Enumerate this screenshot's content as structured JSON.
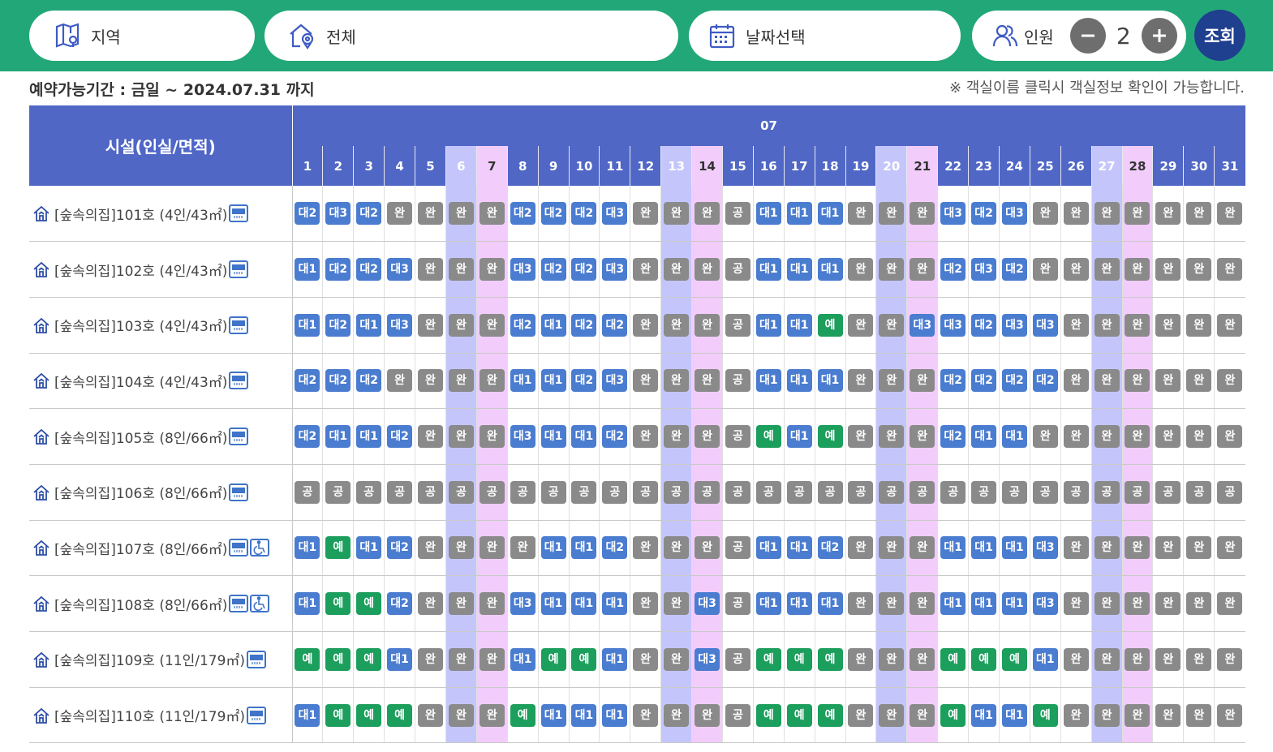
{
  "search": {
    "region_label": "지역",
    "category_label": "전체",
    "date_label": "날짜선택",
    "people_label": "인원",
    "people_count": "2",
    "search_button": "조회"
  },
  "info": {
    "period": "예약가능기간 : 금일 ~ 2024.07.31 까지",
    "notice": "※ 객실이름 클릭시 객실정보 확인이 가능합니다."
  },
  "table": {
    "facility_header": "시설(인실/면적)",
    "month": "07",
    "days": [
      "1",
      "2",
      "3",
      "4",
      "5",
      "6",
      "7",
      "8",
      "9",
      "10",
      "11",
      "12",
      "13",
      "14",
      "15",
      "16",
      "17",
      "18",
      "19",
      "20",
      "21",
      "22",
      "23",
      "24",
      "25",
      "26",
      "27",
      "28",
      "29",
      "30",
      "31"
    ],
    "day_types": [
      "wd",
      "wd",
      "wd",
      "wd",
      "wd",
      "sat",
      "sun",
      "wd",
      "wd",
      "wd",
      "wd",
      "wd",
      "sat",
      "sun",
      "wd",
      "wd",
      "wd",
      "wd",
      "wd",
      "sat",
      "sun",
      "wd",
      "wd",
      "wd",
      "wd",
      "wd",
      "sat",
      "sun",
      "wd",
      "wd",
      "wd"
    ],
    "rooms": [
      {
        "name": "[숲속의집]101호 (4인/43㎡)",
        "accessible": false,
        "cells": [
          "대2",
          "대3",
          "대2",
          "완",
          "완",
          "완",
          "완",
          "대2",
          "대2",
          "대2",
          "대3",
          "완",
          "완",
          "완",
          "공",
          "대1",
          "대1",
          "대1",
          "완",
          "완",
          "완",
          "대3",
          "대2",
          "대3",
          "완",
          "완",
          "완",
          "완",
          "완",
          "완",
          "완"
        ]
      },
      {
        "name": "[숲속의집]102호 (4인/43㎡)",
        "accessible": false,
        "cells": [
          "대1",
          "대2",
          "대2",
          "대3",
          "완",
          "완",
          "완",
          "대3",
          "대2",
          "대2",
          "대3",
          "완",
          "완",
          "완",
          "공",
          "대1",
          "대1",
          "대1",
          "완",
          "완",
          "완",
          "대2",
          "대3",
          "대2",
          "완",
          "완",
          "완",
          "완",
          "완",
          "완",
          "완"
        ]
      },
      {
        "name": "[숲속의집]103호 (4인/43㎡)",
        "accessible": false,
        "cells": [
          "대1",
          "대2",
          "대1",
          "대3",
          "완",
          "완",
          "완",
          "대2",
          "대1",
          "대2",
          "대2",
          "완",
          "완",
          "완",
          "공",
          "대1",
          "대1",
          "예",
          "완",
          "완",
          "대3",
          "대3",
          "대2",
          "대3",
          "대3",
          "완",
          "완",
          "완",
          "완",
          "완",
          "완"
        ]
      },
      {
        "name": "[숲속의집]104호 (4인/43㎡)",
        "accessible": false,
        "cells": [
          "대2",
          "대2",
          "대2",
          "완",
          "완",
          "완",
          "완",
          "대1",
          "대1",
          "대2",
          "대3",
          "완",
          "완",
          "완",
          "공",
          "대1",
          "대1",
          "대1",
          "완",
          "완",
          "완",
          "대2",
          "대2",
          "대2",
          "대2",
          "완",
          "완",
          "완",
          "완",
          "완",
          "완"
        ]
      },
      {
        "name": "[숲속의집]105호 (8인/66㎡)",
        "accessible": false,
        "cells": [
          "대2",
          "대1",
          "대1",
          "대2",
          "완",
          "완",
          "완",
          "대3",
          "대1",
          "대1",
          "대2",
          "완",
          "완",
          "완",
          "공",
          "예",
          "대1",
          "예",
          "완",
          "완",
          "완",
          "대2",
          "대1",
          "대1",
          "완",
          "완",
          "완",
          "완",
          "완",
          "완",
          "완"
        ]
      },
      {
        "name": "[숲속의집]106호 (8인/66㎡)",
        "accessible": false,
        "cells": [
          "공",
          "공",
          "공",
          "공",
          "공",
          "공",
          "공",
          "공",
          "공",
          "공",
          "공",
          "공",
          "공",
          "공",
          "공",
          "공",
          "공",
          "공",
          "공",
          "공",
          "공",
          "공",
          "공",
          "공",
          "공",
          "공",
          "공",
          "공",
          "공",
          "공",
          "공"
        ]
      },
      {
        "name": "[숲속의집]107호 (8인/66㎡)",
        "accessible": true,
        "cells": [
          "대1",
          "예",
          "대1",
          "대2",
          "완",
          "완",
          "완",
          "완",
          "대1",
          "대1",
          "대2",
          "완",
          "완",
          "완",
          "공",
          "대1",
          "대1",
          "대2",
          "완",
          "완",
          "완",
          "대1",
          "대1",
          "대1",
          "대3",
          "완",
          "완",
          "완",
          "완",
          "완",
          "완"
        ]
      },
      {
        "name": "[숲속의집]108호 (8인/66㎡)",
        "accessible": true,
        "cells": [
          "대1",
          "예",
          "예",
          "대2",
          "완",
          "완",
          "완",
          "대3",
          "대1",
          "대1",
          "대1",
          "완",
          "완",
          "대3",
          "공",
          "대1",
          "대1",
          "대1",
          "완",
          "완",
          "완",
          "대1",
          "대1",
          "대1",
          "대3",
          "완",
          "완",
          "완",
          "완",
          "완",
          "완"
        ]
      },
      {
        "name": "[숲속의집]109호 (11인/179㎡)",
        "accessible": false,
        "cells": [
          "예",
          "예",
          "예",
          "대1",
          "완",
          "완",
          "완",
          "대1",
          "예",
          "예",
          "대1",
          "완",
          "완",
          "대3",
          "공",
          "예",
          "예",
          "예",
          "완",
          "완",
          "완",
          "예",
          "예",
          "예",
          "대1",
          "완",
          "완",
          "완",
          "완",
          "완",
          "완"
        ]
      },
      {
        "name": "[숲속의집]110호 (11인/179㎡)",
        "accessible": false,
        "cells": [
          "대1",
          "예",
          "예",
          "예",
          "완",
          "완",
          "완",
          "예",
          "대1",
          "대1",
          "대1",
          "완",
          "완",
          "완",
          "공",
          "예",
          "예",
          "예",
          "완",
          "완",
          "완",
          "예",
          "대1",
          "대1",
          "예",
          "완",
          "완",
          "완",
          "완",
          "완",
          "완"
        ]
      }
    ]
  },
  "colors": {
    "header_green": "#22a878",
    "table_header": "#5067c6",
    "saturday": "#c4c6fb",
    "sunday": "#f2ccfa",
    "status_waiting": "#4a7cd0",
    "status_closed": "#8a8a8a",
    "status_available": "#1c9e5c"
  },
  "icons": {
    "region": "map-icon",
    "category": "home-pin-icon",
    "date": "calendar-icon",
    "people": "people-icon",
    "room": "house-icon",
    "ac": "air-conditioner-icon",
    "accessible": "wheelchair-icon"
  }
}
